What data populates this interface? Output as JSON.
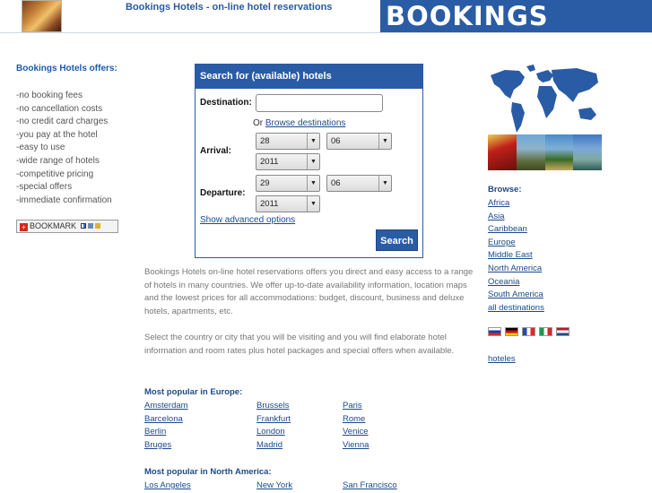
{
  "header": {
    "tagline": "Bookings Hotels - on-line hotel reservations",
    "logo_text": "BOOKINGS"
  },
  "offers": {
    "title": "Bookings Hotels offers:",
    "items": [
      "-no booking fees",
      "-no cancellation costs",
      "-no credit card charges",
      "-you pay at the hotel",
      "-easy to use",
      "-wide range of hotels",
      "-competitive pricing",
      "-special offers",
      "-immediate confirmation"
    ],
    "bookmark_label": "BOOKMARK"
  },
  "search": {
    "title": "Search for (available) hotels",
    "destination_label": "Destination:",
    "destination_value": "",
    "or_text": "Or",
    "browse_link": "Browse destinations",
    "arrival_label": "Arrival:",
    "arrival_day": "28",
    "arrival_month": "06",
    "arrival_year": "2011",
    "departure_label": "Departure:",
    "departure_day": "29",
    "departure_month": "06",
    "departure_year": "2011",
    "advanced_link": "Show advanced options",
    "button_label": "Search"
  },
  "main": {
    "paragraph_1": "Bookings Hotels on-line hotel reservations offers you direct and easy access to a range of hotels in many countries. We offer up-to-date availability information, location maps and the lowest prices for all accommodations: budget, discount, business and deluxe hotels, apartments, etc.",
    "paragraph_2": "Select the country or city that you will be visiting and you will find elaborate hotel information and room rates plus hotel packages and special offers when available."
  },
  "popular_europe": {
    "title": "Most popular in Europe:",
    "col1": [
      "Amsterdam",
      "Barcelona",
      "Berlin",
      "Bruges"
    ],
    "col2": [
      "Brussels",
      "Frankfurt",
      "London",
      "Madrid"
    ],
    "col3": [
      "Paris",
      "Rome",
      "Venice",
      "Vienna"
    ]
  },
  "popular_na": {
    "title": "Most popular in North America:",
    "col1": [
      "Los Angeles"
    ],
    "col2": [
      "New York"
    ],
    "col3": [
      "San Francisco"
    ]
  },
  "browse": {
    "title": "Browse:",
    "items": [
      "Africa",
      "Asia",
      "Caribbean",
      "Europe",
      "Middle East",
      "North America",
      "Oceania",
      "South America",
      "all destinations"
    ],
    "hoteles_link": "hoteles"
  },
  "colors": {
    "brand_blue": "#2a5ba5",
    "link_blue": "#1a4a8a"
  },
  "flags": [
    "flag-ru-icon",
    "flag-de-icon",
    "flag-fr-icon",
    "flag-it-icon",
    "flag-nl-icon"
  ]
}
